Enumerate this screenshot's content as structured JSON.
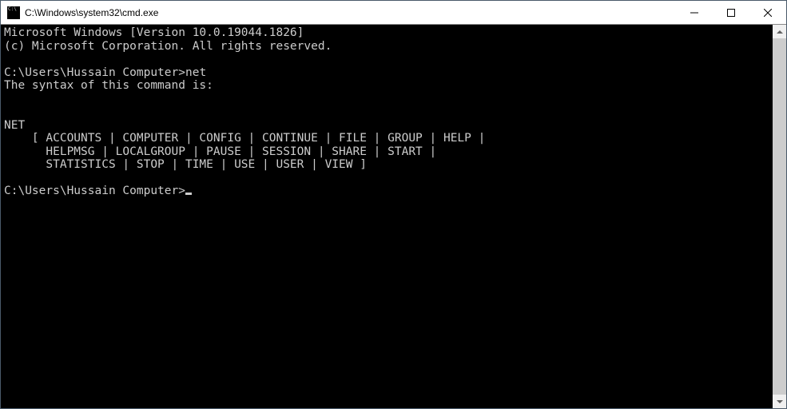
{
  "window": {
    "title": "C:\\Windows\\system32\\cmd.exe"
  },
  "controls": {
    "minimize": "—",
    "maximize": "▢",
    "close": "✕"
  },
  "console": {
    "banner1": "Microsoft Windows [Version 10.0.19044.1826]",
    "banner2": "(c) Microsoft Corporation. All rights reserved.",
    "blank": "",
    "prompt1": "C:\\Users\\Hussain Computer>",
    "command1": "net",
    "syntax_msg": "The syntax of this command is:",
    "net_header": "NET",
    "net_row1": "    [ ACCOUNTS | COMPUTER | CONFIG | CONTINUE | FILE | GROUP | HELP |",
    "net_row2": "      HELPMSG | LOCALGROUP | PAUSE | SESSION | SHARE | START |",
    "net_row3": "      STATISTICS | STOP | TIME | USE | USER | VIEW ]",
    "prompt2": "C:\\Users\\Hussain Computer>"
  }
}
